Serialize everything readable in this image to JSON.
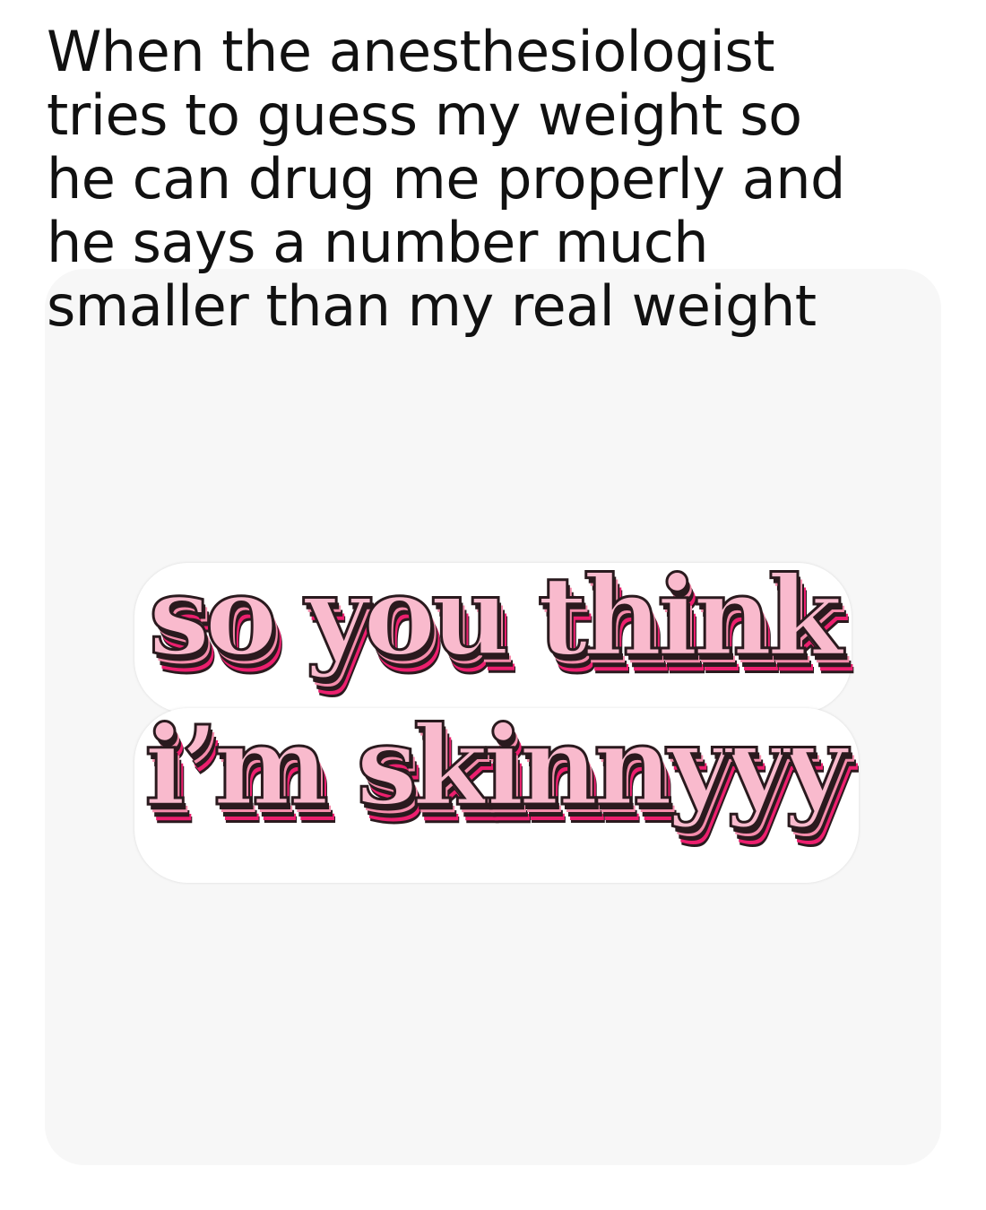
{
  "caption": {
    "lines": [
      "When the anesthesiologist",
      "tries to guess my weight so",
      "he can drug me properly and",
      "he says a number much",
      "smaller than my real weight"
    ]
  },
  "sticker": {
    "line1": "so you think",
    "line2": "i’m skinnyyy",
    "colors": {
      "fill": "#f9bacd",
      "mid": "#f48cab",
      "deep": "#ec1f6e",
      "outline": "#2a1a1e",
      "backing": "#ffffff"
    }
  },
  "panel": {
    "background": "#f7f7f7"
  }
}
